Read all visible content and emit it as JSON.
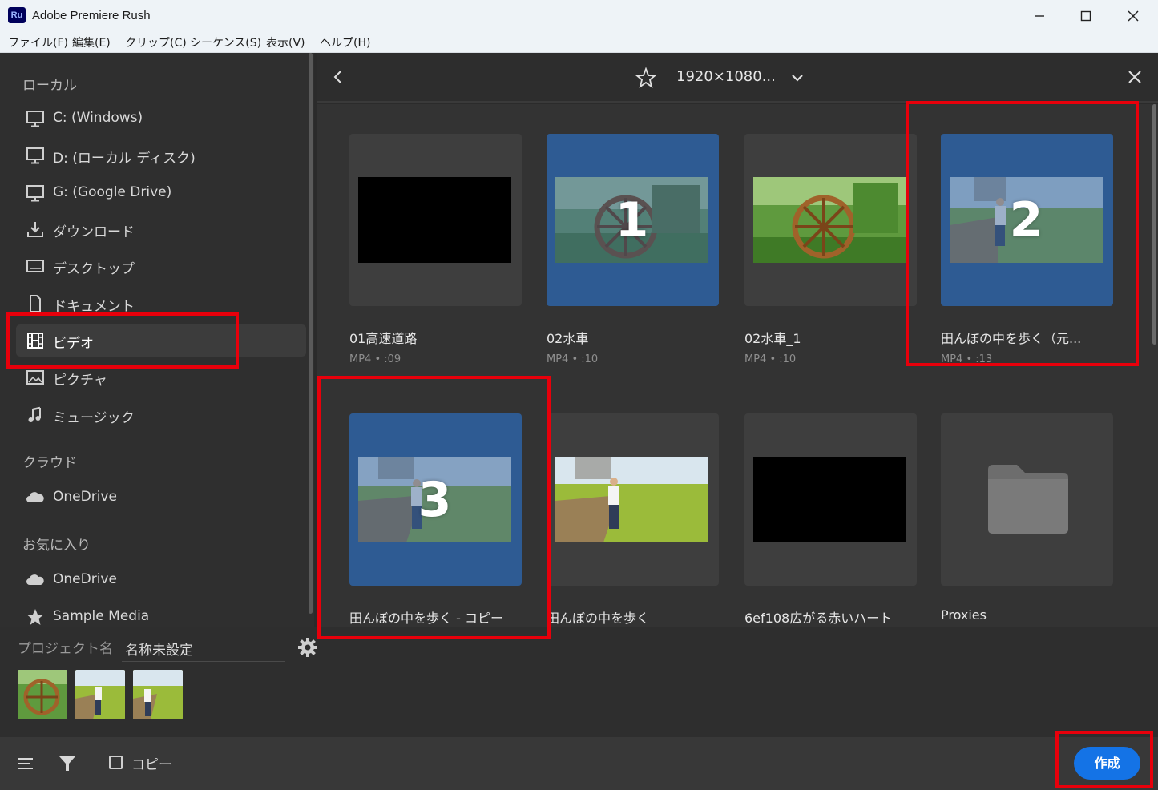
{
  "window": {
    "title": "Adobe Premiere Rush",
    "app_icon_text": "Ru"
  },
  "menu": [
    "ファイル(F)",
    "編集(E)",
    "クリップ(C)",
    "シーケンス(S)",
    "表示(V)",
    "ヘルプ(H)"
  ],
  "sidebar": {
    "local_header": "ローカル",
    "local_items": [
      {
        "label": "C: (Windows)",
        "icon": "monitor-icon"
      },
      {
        "label": "D: (ローカル ディスク)",
        "icon": "monitor-icon"
      },
      {
        "label": "G: (Google Drive)",
        "icon": "monitor-icon"
      },
      {
        "label": "ダウンロード",
        "icon": "download-icon"
      },
      {
        "label": "デスクトップ",
        "icon": "desktop-icon"
      },
      {
        "label": "ドキュメント",
        "icon": "document-icon"
      },
      {
        "label": "ビデオ",
        "icon": "film-icon",
        "active": true
      },
      {
        "label": "ピクチャ",
        "icon": "picture-icon"
      },
      {
        "label": "ミュージック",
        "icon": "music-icon"
      }
    ],
    "cloud_header": "クラウド",
    "cloud_items": [
      {
        "label": "OneDrive",
        "icon": "cloud-icon"
      }
    ],
    "favorites_header": "お気に入り",
    "favorite_items": [
      {
        "label": "OneDrive",
        "icon": "cloud-icon"
      },
      {
        "label": "Sample Media",
        "icon": "star-icon"
      }
    ]
  },
  "main": {
    "resolution_label": "1920×1080...",
    "files": [
      {
        "name": "01高速道路",
        "meta": "MP4 • :09",
        "selected": false
      },
      {
        "name": "02水車",
        "meta": "MP4 • :10",
        "selected": true,
        "badge": "1"
      },
      {
        "name": "02水車_1",
        "meta": "MP4 • :10",
        "selected": false
      },
      {
        "name": "田んぼの中を歩く（元...",
        "meta": "MP4 • :13",
        "selected": true,
        "badge": "2"
      },
      {
        "name": "田んぼの中を歩く - コピー",
        "meta": "",
        "selected": true,
        "badge": "3"
      },
      {
        "name": "田んぼの中を歩く",
        "meta": "",
        "selected": false
      },
      {
        "name": "6ef108広がる赤いハート",
        "meta": "",
        "selected": false
      },
      {
        "name": "Proxies",
        "meta": "",
        "selected": false,
        "type": "folder"
      }
    ]
  },
  "project": {
    "label": "プロジェクト名",
    "name": "名称未設定"
  },
  "bottom": {
    "copy_label": "コピー",
    "copy_checked": false,
    "create_label": "作成"
  },
  "colors": {
    "accent": "#1473e6",
    "selected_card": "#2e5b93",
    "annotation": "#e8000b"
  }
}
